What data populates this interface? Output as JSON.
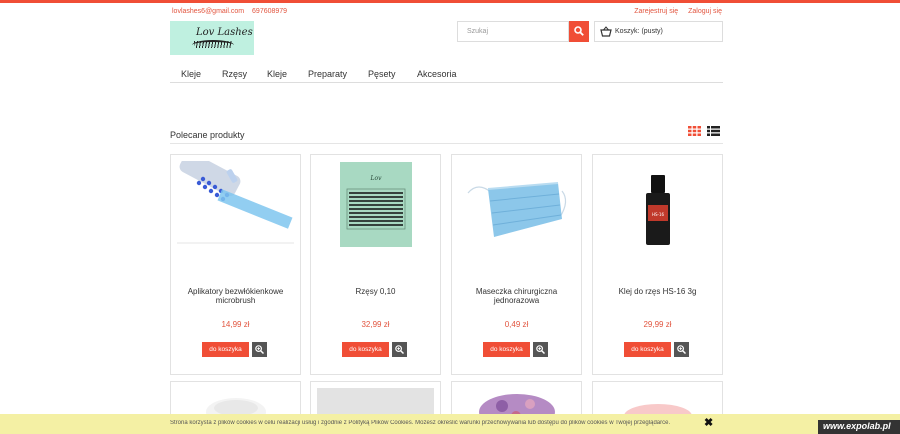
{
  "header": {
    "email": "lovlashes6@gmail.com",
    "phone": "697608979",
    "register": "Zarejestruj się",
    "login": "Zaloguj się",
    "logo_text": "Lov Lashes",
    "search_placeholder": "Szukaj",
    "cart_label": "Koszyk: (pusty)"
  },
  "menu": [
    "Kleje",
    "Rzęsy",
    "Kleje",
    "Preparaty",
    "Pęsety",
    "Akcesoria"
  ],
  "section": {
    "title": "Polecane produkty"
  },
  "products": [
    {
      "name": "Aplikatory bezwłókienkowe microbrush",
      "price": "14,99 zł",
      "add_label": "do koszyka"
    },
    {
      "name": "Rzęsy 0,10",
      "price": "32,99 zł",
      "add_label": "do koszyka"
    },
    {
      "name": "Maseczka chirurgiczna jednorazowa",
      "price": "0,49 zł",
      "add_label": "do koszyka"
    },
    {
      "name": "Klej do rzęs HS-16 3g",
      "price": "29,99 zł",
      "add_label": "do koszyka"
    }
  ],
  "cookie": {
    "text": "Strona korzysta z plików cookies w celu realizacji usług i zgodnie z Polityką Plików Cookies. Możesz określić warunki przechowywania lub dostępu do plików cookies w Twojej przeglądarce.",
    "close": "✖"
  },
  "watermark": "www.expolab.pl",
  "colors": {
    "accent": "#f04e36",
    "logo_bg": "#bff0e0",
    "cookie_bg": "#f4f0a4"
  }
}
